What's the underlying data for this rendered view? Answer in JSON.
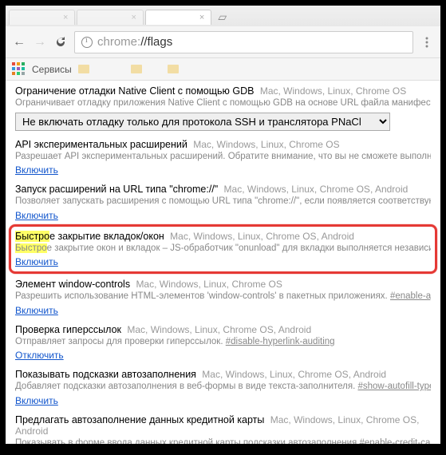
{
  "tabs": [
    {
      "label": ""
    },
    {
      "label": ""
    },
    {
      "label": ""
    }
  ],
  "toolbar": {
    "url_prefix": "chrome:",
    "url_path": "//flags"
  },
  "bookmarks": {
    "apps_label": "Сервисы"
  },
  "flags": [
    {
      "title": "Ограничение отладки Native Client с помощью GDB",
      "platforms": "Mac, Windows, Linux, Chrome OS",
      "desc": "Ограничивает отладку приложения Native Client с помощью GDB на основе URL файла манифеста. Чтоб",
      "select_value": "Не включать отладку только для протокола SSH и транслятора PNaCl",
      "has_select": true
    },
    {
      "title": "API экспериментальных расширений",
      "platforms": "Mac, Windows, Linux, Chrome OS",
      "desc": "Разрешает API экспериментальных расширений. Обратите внимание, что вы не сможете выполнять загр",
      "link": "Включить"
    },
    {
      "title": "Запуск расширений на URL типа \"chrome://\"",
      "platforms": "Mac, Windows, Linux, Chrome OS, Android",
      "desc": "Позволяет запускать расширения с помощью URL типа \"chrome://\", если появляется соответствующее ра",
      "link": "Включить"
    },
    {
      "title_hl_prefix": "Быстро",
      "title_hl_rest": "е закрытие вкладок/окон",
      "platforms": "Mac, Windows, Linux, Chrome OS, Android",
      "desc_hl_prefix": "Быстро",
      "desc_hl_rest": "е закрытие окон и вкладок – JS-обработчик \"onunload\" для вкладки выполняется независимо от",
      "link": "Включить",
      "highlighted": true
    },
    {
      "title": "Элемент window-controls",
      "platforms": "Mac, Windows, Linux, Chrome OS",
      "desc": "Разрешить использование HTML-элементов 'window-controls' в пакетных приложениях.",
      "tag": "#enable-app-win",
      "link": "Включить"
    },
    {
      "title": "Проверка гиперссылок",
      "platforms": "Mac, Windows, Linux, Chrome OS, Android",
      "desc": "Отправляет запросы для проверки гиперссылок.",
      "tag": "#disable-hyperlink-auditing",
      "link": "Отключить"
    },
    {
      "title": "Показывать подсказки автозаполнения",
      "platforms": "Mac, Windows, Linux, Chrome OS, Android",
      "desc": "Добавляет подсказки автозаполнения в веб-формы в виде текста-заполнителя.",
      "tag": "#show-autofill-type-pred",
      "link": "Включить"
    },
    {
      "title": "Предлагать автозаполнение данных кредитной карты",
      "platforms": "Mac, Windows, Linux, Chrome OS, Android",
      "desc": "Показывать в форме ввода данных кредитной карты подсказки автозаполнения",
      "tag": "#enable-credit-card-s"
    }
  ]
}
